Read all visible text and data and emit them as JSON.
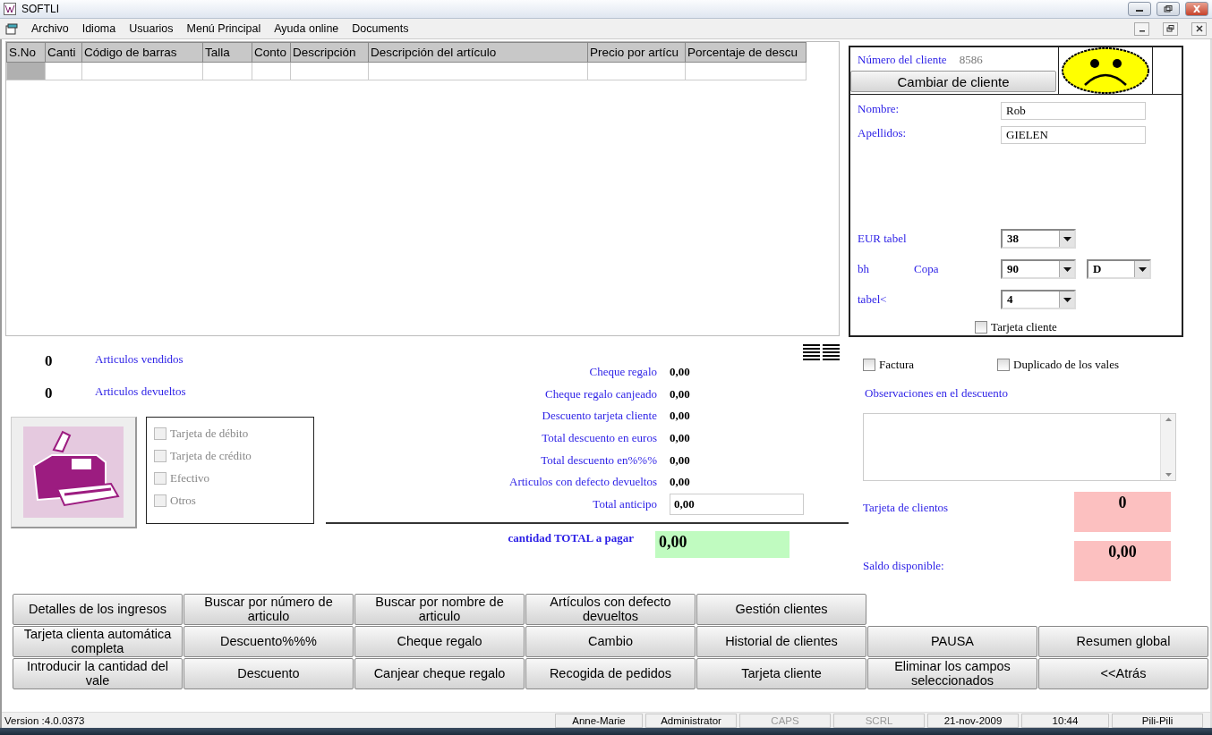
{
  "window": {
    "title": "SOFTLI"
  },
  "menu": [
    "Archivo",
    "Idioma",
    "Usuarios",
    "Menú Principal",
    "Ayuda online",
    "Documents"
  ],
  "table": {
    "columns": [
      "S.No",
      "Canti",
      "Código de barras",
      "Talla",
      "Conto",
      "Descripción",
      "Descripción del artículo",
      "Precio por artícu",
      "Porcentaje de descu"
    ]
  },
  "customer": {
    "number_label": "Número del cliente",
    "number": "8586",
    "change_button": "Cambiar de cliente",
    "name_label": "Nombre:",
    "name": "Rob",
    "surname_label": "Apellidos:",
    "surname": "GIELEN",
    "sizes": [
      {
        "labels": [
          "EUR tabel"
        ],
        "selects": [
          "38"
        ]
      },
      {
        "labels": [
          "bh",
          "Copa"
        ],
        "selects": [
          "90",
          "D"
        ]
      },
      {
        "labels": [
          "tabel<"
        ],
        "selects": [
          "4"
        ]
      }
    ],
    "card": {
      "label": "Tarjeta cliente",
      "checked": false
    }
  },
  "counters": [
    {
      "value": "0",
      "label": "Articulos vendidos"
    },
    {
      "value": "0",
      "label": "Articulos devueltos"
    }
  ],
  "payments": [
    {
      "label": "Tarjeta de débito",
      "checked": false,
      "disabled": true
    },
    {
      "label": "Tarjeta de crédito",
      "checked": false,
      "disabled": true
    },
    {
      "label": "Efectivo",
      "checked": false,
      "disabled": true
    },
    {
      "label": "Otros",
      "checked": false,
      "disabled": true
    }
  ],
  "totals": [
    {
      "label": "Cheque regalo",
      "value": "0,00",
      "kind": "text"
    },
    {
      "label": "Cheque regalo canjeado",
      "value": "0,00",
      "kind": "text"
    },
    {
      "label": "Descuento tarjeta cliente",
      "value": "0,00",
      "kind": "text"
    },
    {
      "label": "Total descuento en euros",
      "value": "0,00",
      "kind": "text"
    },
    {
      "label": "Total descuento en%%%",
      "value": "0,00",
      "kind": "text"
    },
    {
      "label": "Articulos con defecto devueltos",
      "value": "0,00",
      "kind": "text"
    },
    {
      "label": "Total anticipo",
      "value": "0,00",
      "kind": "field"
    }
  ],
  "total_due": {
    "label": "cantidad TOTAL a pagar",
    "value": "0,00"
  },
  "options": [
    {
      "label": "Factura",
      "checked": false
    },
    {
      "label": "Duplicado de los vales",
      "checked": false
    }
  ],
  "observations": {
    "label": "Observaciones en el descuento"
  },
  "balances": [
    {
      "label": "Tarjeta de clientos",
      "value": "0"
    },
    {
      "label": "Saldo disponible:",
      "value": "0,00"
    }
  ],
  "buttons": [
    [
      "Detalles de los ingresos",
      "Buscar por número de articulo",
      "Buscar por nombre de articulo",
      "Artículos con defecto devueltos",
      "Gestión clientes"
    ],
    [
      "Tarjeta clienta automática completa",
      "Descuento%%%",
      "Cheque regalo",
      "Cambio",
      "Historial de clientes",
      "PAUSA",
      "Resumen global"
    ],
    [
      "Introducir la cantidad del vale",
      "Descuento",
      "Canjear cheque regalo",
      "Recogida de pedidos",
      "Tarjeta cliente",
      "Eliminar los campos seleccionados",
      "<<Atrás"
    ]
  ],
  "status_bar": [
    {
      "text": "Version :4.0.0373",
      "disabled": false
    },
    {
      "text": "Anne-Marie",
      "disabled": false
    },
    {
      "text": "Administrator",
      "disabled": false
    },
    {
      "text": "CAPS",
      "disabled": true
    },
    {
      "text": "SCRL",
      "disabled": true
    },
    {
      "text": "21-nov-2009",
      "disabled": false
    },
    {
      "text": "10:44",
      "disabled": false
    },
    {
      "text": "Pili-Pili",
      "disabled": false
    }
  ]
}
